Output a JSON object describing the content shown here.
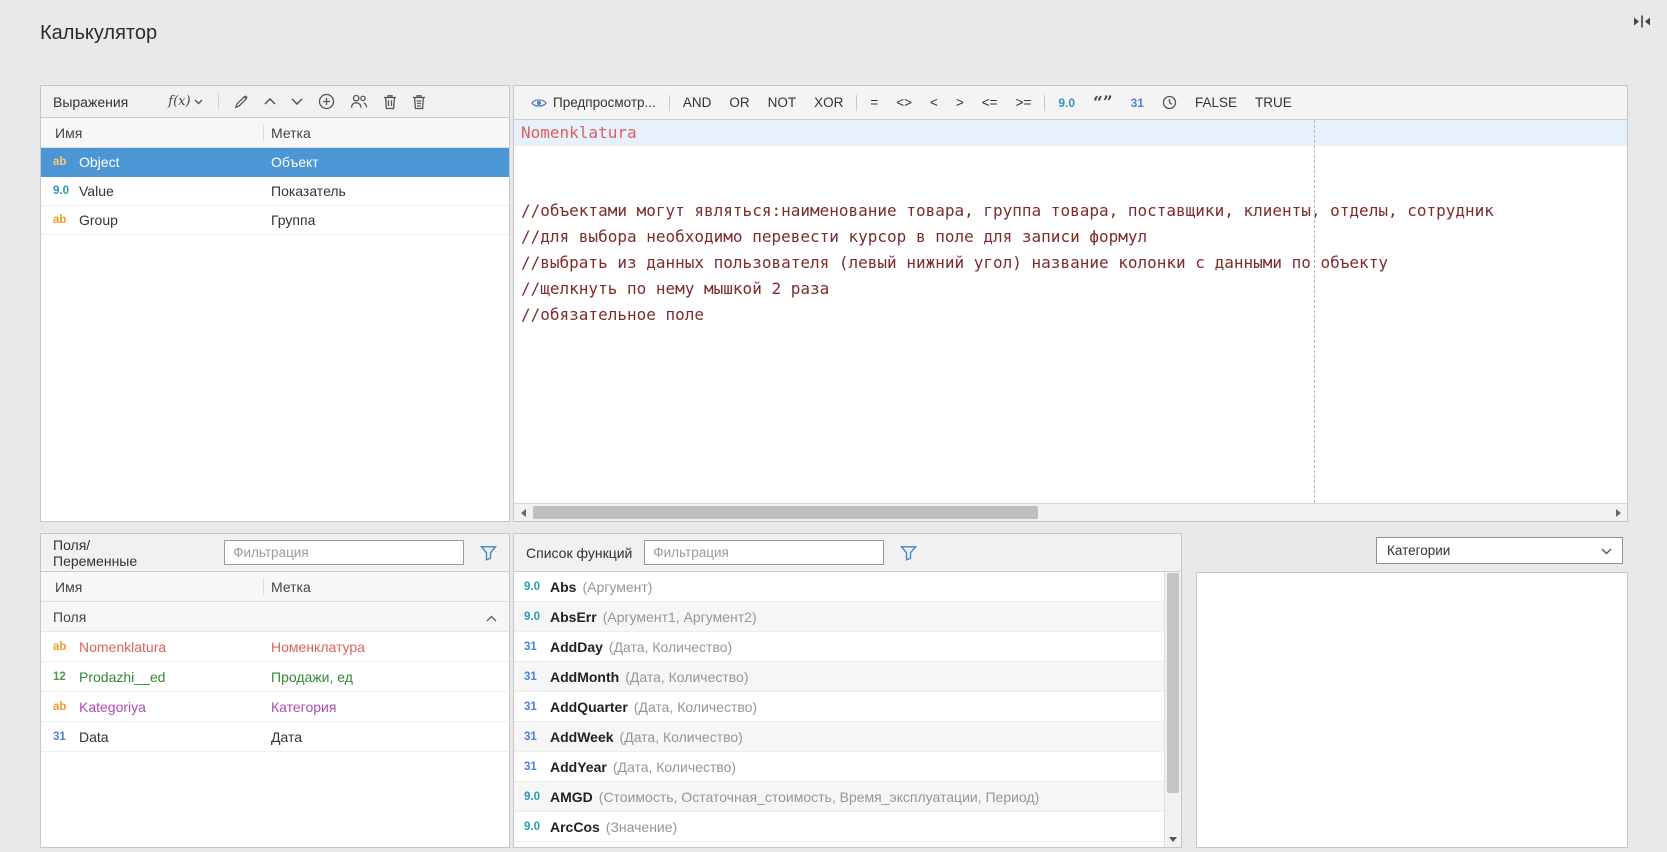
{
  "colors": {
    "selection_blue": "#4d96d5",
    "field_red": "#e06060",
    "field_green": "#338a33",
    "field_purple": "#b24ab2",
    "icon_orange": "#ef9a2a",
    "icon_teal": "#2a97b9",
    "icon_green": "#43a047",
    "icon_blue": "#4a82d6",
    "comment_maroon": "#7d2b2b"
  },
  "page": {
    "title": "Калькулятор"
  },
  "expressions": {
    "title": "Выражения",
    "fx_label": "f(x)",
    "toolbar_icons": [
      "fx-dropdown",
      "edit",
      "move-up",
      "move-down",
      "add",
      "group",
      "delete",
      "clear-all"
    ],
    "columns": [
      "Имя",
      "Метка"
    ],
    "rows": [
      {
        "icon": "ab",
        "name": "Object",
        "label": "Объект"
      },
      {
        "icon": "9.0",
        "name": "Value",
        "label": "Показатель"
      },
      {
        "icon": "ab",
        "name": "Group",
        "label": "Группа"
      }
    ]
  },
  "formula": {
    "toolbar": {
      "preview": "Предпросмотр...",
      "ops": [
        "AND",
        "OR",
        "NOT",
        "XOR"
      ],
      "cmps": [
        "=",
        "<>",
        "<",
        ">",
        "<=",
        ">="
      ],
      "number": "9.0",
      "quotes": "“”",
      "date": "31",
      "bools": [
        "FALSE",
        "TRUE"
      ]
    },
    "editor": {
      "line1": "Nomenklatura",
      "comments": [
        "//объектами могут являться:наименование товара, группа товара, поставщики, клиенты, отделы, сотрудник",
        "//для выбора необходимо перевести курсор в поле для записи формул",
        "//выбрать из данных пользователя (левый нижний угол) название колонки с данными по объекту",
        "//щелкнуть по нему мышкой 2 раза",
        "//обязательное поле"
      ]
    }
  },
  "fields": {
    "title": "Поля/Переменные",
    "filter_placeholder": "Фильтрация",
    "columns": [
      "Имя",
      "Метка"
    ],
    "group_label": "Поля",
    "rows": [
      {
        "icon": "ab",
        "name": "Nomenklatura",
        "label": "Номенклатура"
      },
      {
        "icon": "12",
        "name": "Prodazhi__ed",
        "label": "Продажи, ед"
      },
      {
        "icon": "ab",
        "name": "Kategoriya",
        "label": "Категория"
      },
      {
        "icon": "31",
        "name": "Data",
        "label": "Дата"
      }
    ]
  },
  "functions": {
    "title": "Список функций",
    "filter_placeholder": "Фильтрация",
    "category_selected": "Категории",
    "items": [
      {
        "icon": "9.0",
        "name": "Abs",
        "args": "(Аргумент)"
      },
      {
        "icon": "9.0",
        "name": "AbsErr",
        "args": "(Аргумент1, Аргумент2)"
      },
      {
        "icon": "31",
        "name": "AddDay",
        "args": "(Дата, Количество)"
      },
      {
        "icon": "31",
        "name": "AddMonth",
        "args": "(Дата, Количество)"
      },
      {
        "icon": "31",
        "name": "AddQuarter",
        "args": "(Дата, Количество)"
      },
      {
        "icon": "31",
        "name": "AddWeek",
        "args": "(Дата, Количество)"
      },
      {
        "icon": "31",
        "name": "AddYear",
        "args": "(Дата, Количество)"
      },
      {
        "icon": "9.0",
        "name": "AMGD",
        "args": "(Стоимость, Остаточная_стоимость, Время_эксплуатации, Период)"
      },
      {
        "icon": "9.0",
        "name": "ArcCos",
        "args": "(Значение)"
      }
    ]
  }
}
